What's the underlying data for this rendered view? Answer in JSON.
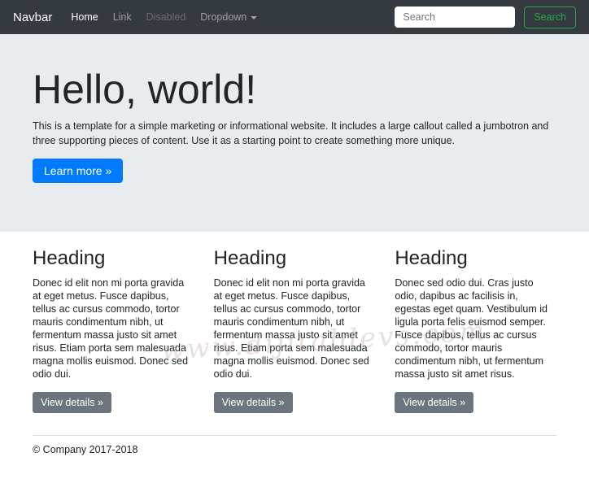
{
  "navbar": {
    "brand": "Navbar",
    "items": [
      {
        "label": "Home",
        "state": "active"
      },
      {
        "label": "Link",
        "state": "normal"
      },
      {
        "label": "Disabled",
        "state": "disabled"
      },
      {
        "label": "Dropdown",
        "state": "dropdown"
      }
    ],
    "search": {
      "placeholder": "Search",
      "button_label": "Search"
    }
  },
  "jumbotron": {
    "title": "Hello, world!",
    "description": "This is a template for a simple marketing or informational website. It includes a large callout called a jumbotron and three supporting pieces of content. Use it as a starting point to create something more unique.",
    "cta_label": "Learn more »"
  },
  "columns": [
    {
      "heading": "Heading",
      "text": "Donec id elit non mi porta gravida at eget metus. Fusce dapibus, tellus ac cursus commodo, tortor mauris condimentum nibh, ut fermentum massa justo sit amet risus. Etiam porta sem malesuada magna mollis euismod. Donec sed odio dui.",
      "button_label": "View details »"
    },
    {
      "heading": "Heading",
      "text": "Donec id elit non mi porta gravida at eget metus. Fusce dapibus, tellus ac cursus commodo, tortor mauris condimentum nibh, ut fermentum massa justo sit amet risus. Etiam porta sem malesuada magna mollis euismod. Donec sed odio dui.",
      "button_label": "View details »"
    },
    {
      "heading": "Heading",
      "text": "Donec sed odio dui. Cras justo odio, dapibus ac facilisis in, egestas eget quam. Vestibulum id ligula porta felis euismod semper. Fusce dapibus, tellus ac cursus commodo, tortor mauris condimentum nibh, ut fermentum massa justo sit amet risus.",
      "button_label": "View details »"
    }
  ],
  "footer": {
    "copyright": "© Company 2017-2018"
  },
  "watermark": {
    "text": "www.dijitaldevs.com"
  },
  "colors": {
    "navbar_bg": "#343a40",
    "jumbotron_bg": "#e9ecef",
    "primary": "#007bff",
    "secondary": "#6c757d",
    "success": "#28a745",
    "body_text": "#212529"
  }
}
